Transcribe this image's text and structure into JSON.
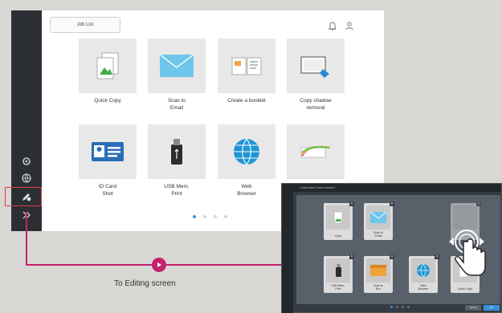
{
  "main": {
    "job_list_label": "Job List",
    "tiles": [
      {
        "label": "Quick Copy",
        "icon": "copy-icon"
      },
      {
        "label": "Scan to\nEmail",
        "icon": "envelope-icon"
      },
      {
        "label": "Create a booklet",
        "icon": "booklet-icon"
      },
      {
        "label": "Copy shadow\nremoval",
        "icon": "shadow-removal-icon"
      },
      {
        "label": "ID Card\nShot",
        "icon": "id-card-icon"
      },
      {
        "label": "USB Mem.\nPrint",
        "icon": "usb-icon"
      },
      {
        "label": "Web\nBrowser",
        "icon": "globe-icon"
      },
      {
        "label": "",
        "icon": "color-swatch-icon"
      }
    ]
  },
  "caption": "To Editing screen",
  "editing": {
    "title": "Customize Home screen",
    "tiles": [
      {
        "label": "Copy"
      },
      {
        "label": "Scan to\nEmail"
      },
      {
        "label": ""
      },
      {
        "label": "USB Mem.\nPrint"
      },
      {
        "label": "Scan to\nBox"
      },
      {
        "label": "Web\nBrowser"
      },
      {
        "label": "Quick Copy"
      }
    ],
    "cancel_label": "Cancel",
    "ok_label": "OK"
  },
  "colors": {
    "accent": "#c2236f",
    "highlight": "#e23a48",
    "blue": "#3a8fd8"
  }
}
